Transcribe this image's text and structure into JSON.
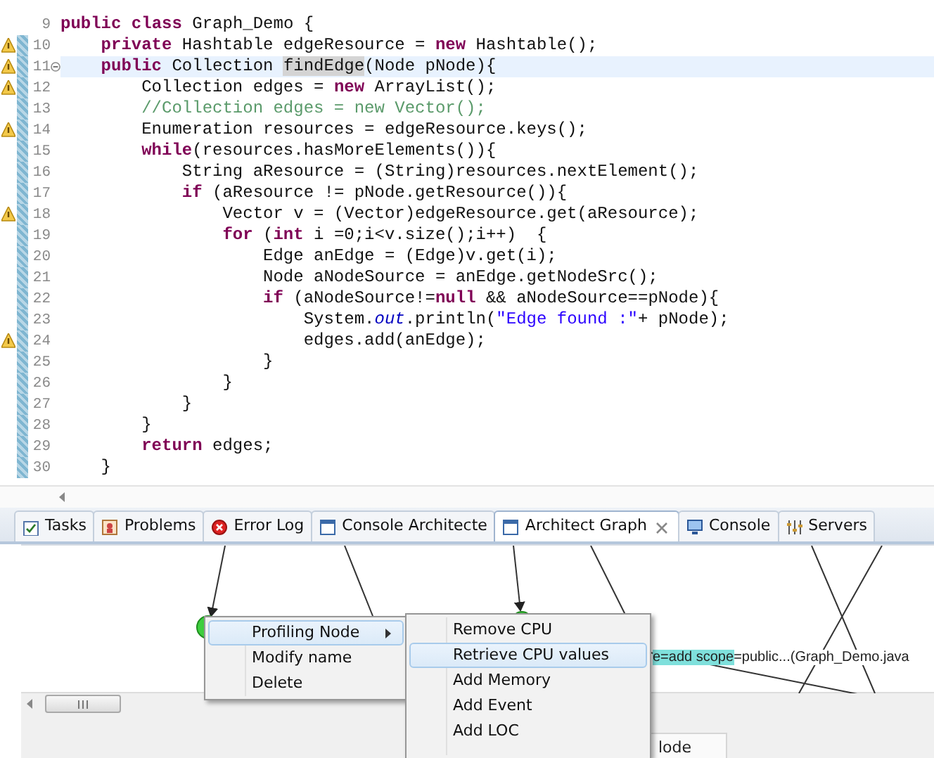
{
  "editor": {
    "lines": [
      {
        "number": "9",
        "warning": false,
        "foldable": false,
        "current": false,
        "changed": false,
        "tokens": [
          {
            "kind": "keyword",
            "text": "public "
          },
          {
            "kind": "keyword",
            "text": "class"
          },
          {
            "kind": "plain",
            "text": " Graph_Demo {"
          }
        ]
      },
      {
        "number": "10",
        "warning": true,
        "foldable": false,
        "current": false,
        "changed": true,
        "tokens": [
          {
            "kind": "keyword",
            "text": "    private"
          },
          {
            "kind": "plain",
            "text": " Hashtable edgeResource = "
          },
          {
            "kind": "keyword",
            "text": "new"
          },
          {
            "kind": "plain",
            "text": " Hashtable();"
          }
        ]
      },
      {
        "number": "11",
        "warning": true,
        "foldable": true,
        "current": true,
        "changed": true,
        "tokens": [
          {
            "kind": "keyword",
            "text": "    public"
          },
          {
            "kind": "plain",
            "text": " Collection "
          },
          {
            "kind": "occurrence",
            "text": "findEdge"
          },
          {
            "kind": "plain",
            "text": "(Node pNode){"
          }
        ]
      },
      {
        "number": "12",
        "warning": true,
        "foldable": false,
        "current": false,
        "changed": true,
        "tokens": [
          {
            "kind": "plain",
            "text": "        Collection edges = "
          },
          {
            "kind": "keyword",
            "text": "new"
          },
          {
            "kind": "plain",
            "text": " ArrayList();"
          }
        ]
      },
      {
        "number": "13",
        "warning": false,
        "foldable": false,
        "current": false,
        "changed": true,
        "tokens": [
          {
            "kind": "comment",
            "text": "        //Collection edges = new Vector();"
          }
        ]
      },
      {
        "number": "14",
        "warning": true,
        "foldable": false,
        "current": false,
        "changed": true,
        "tokens": [
          {
            "kind": "plain",
            "text": "        Enumeration resources = edgeResource.keys();"
          }
        ]
      },
      {
        "number": "15",
        "warning": false,
        "foldable": false,
        "current": false,
        "changed": true,
        "tokens": [
          {
            "kind": "keyword",
            "text": "        while"
          },
          {
            "kind": "plain",
            "text": "(resources.hasMoreElements()){"
          }
        ]
      },
      {
        "number": "16",
        "warning": false,
        "foldable": false,
        "current": false,
        "changed": true,
        "tokens": [
          {
            "kind": "plain",
            "text": "            String aResource = (String)resources.nextElement();"
          }
        ]
      },
      {
        "number": "17",
        "warning": false,
        "foldable": false,
        "current": false,
        "changed": true,
        "tokens": [
          {
            "kind": "keyword",
            "text": "            if"
          },
          {
            "kind": "plain",
            "text": " (aResource != pNode.getResource()){"
          }
        ]
      },
      {
        "number": "18",
        "warning": true,
        "foldable": false,
        "current": false,
        "changed": true,
        "tokens": [
          {
            "kind": "plain",
            "text": "                Vector v = (Vector)edgeResource.get(aResource);"
          }
        ]
      },
      {
        "number": "19",
        "warning": false,
        "foldable": false,
        "current": false,
        "changed": true,
        "tokens": [
          {
            "kind": "keyword",
            "text": "                for"
          },
          {
            "kind": "plain",
            "text": " ("
          },
          {
            "kind": "keyword",
            "text": "int"
          },
          {
            "kind": "plain",
            "text": " i =0;i<v.size();i++)  {"
          }
        ]
      },
      {
        "number": "20",
        "warning": false,
        "foldable": false,
        "current": false,
        "changed": true,
        "tokens": [
          {
            "kind": "plain",
            "text": "                    Edge anEdge = (Edge)v.get(i);"
          }
        ]
      },
      {
        "number": "21",
        "warning": false,
        "foldable": false,
        "current": false,
        "changed": true,
        "tokens": [
          {
            "kind": "plain",
            "text": "                    Node aNodeSource = anEdge.getNodeSrc();"
          }
        ]
      },
      {
        "number": "22",
        "warning": false,
        "foldable": false,
        "current": false,
        "changed": true,
        "tokens": [
          {
            "kind": "keyword",
            "text": "                    if"
          },
          {
            "kind": "plain",
            "text": " (aNodeSource!="
          },
          {
            "kind": "keyword",
            "text": "null"
          },
          {
            "kind": "plain",
            "text": " && aNodeSource==pNode){"
          }
        ]
      },
      {
        "number": "23",
        "warning": false,
        "foldable": false,
        "current": false,
        "changed": true,
        "tokens": [
          {
            "kind": "plain",
            "text": "                        System."
          },
          {
            "kind": "field",
            "text": "out"
          },
          {
            "kind": "plain",
            "text": ".println("
          },
          {
            "kind": "string",
            "text": "\"Edge found :\""
          },
          {
            "kind": "plain",
            "text": "+ pNode);"
          }
        ]
      },
      {
        "number": "24",
        "warning": true,
        "foldable": false,
        "current": false,
        "changed": true,
        "tokens": [
          {
            "kind": "plain",
            "text": "                        edges.add(anEdge);"
          }
        ]
      },
      {
        "number": "25",
        "warning": false,
        "foldable": false,
        "current": false,
        "changed": true,
        "tokens": [
          {
            "kind": "plain",
            "text": "                    }"
          }
        ]
      },
      {
        "number": "26",
        "warning": false,
        "foldable": false,
        "current": false,
        "changed": true,
        "tokens": [
          {
            "kind": "plain",
            "text": "                }"
          }
        ]
      },
      {
        "number": "27",
        "warning": false,
        "foldable": false,
        "current": false,
        "changed": true,
        "tokens": [
          {
            "kind": "plain",
            "text": "            }"
          }
        ]
      },
      {
        "number": "28",
        "warning": false,
        "foldable": false,
        "current": false,
        "changed": true,
        "tokens": [
          {
            "kind": "plain",
            "text": "        }"
          }
        ]
      },
      {
        "number": "29",
        "warning": false,
        "foldable": false,
        "current": false,
        "changed": true,
        "tokens": [
          {
            "kind": "keyword",
            "text": "        return"
          },
          {
            "kind": "plain",
            "text": " edges;"
          }
        ]
      },
      {
        "number": "30",
        "warning": false,
        "foldable": false,
        "current": false,
        "changed": true,
        "tokens": [
          {
            "kind": "plain",
            "text": "    }"
          }
        ]
      }
    ]
  },
  "panel_tabs": [
    {
      "label": "Tasks",
      "selected": false,
      "closable": false
    },
    {
      "label": "Problems",
      "selected": false,
      "closable": false
    },
    {
      "label": "Error Log",
      "selected": false,
      "closable": false
    },
    {
      "label": "Console Architecte",
      "selected": false,
      "closable": false
    },
    {
      "label": "Architect Graph",
      "selected": true,
      "closable": true
    },
    {
      "label": "Console",
      "selected": false,
      "closable": false
    },
    {
      "label": "Servers",
      "selected": false,
      "closable": false
    }
  ],
  "graph": {
    "label_parts": [
      {
        "text": "e=add scope",
        "highlighted": true
      },
      {
        "text": "=public...(Graph_Demo.java",
        "highlighted": false
      }
    ],
    "context_menu": [
      {
        "label": "Profiling Node",
        "selected": true,
        "has_submenu": true
      },
      {
        "label": "Modify name",
        "selected": false,
        "has_submenu": false
      },
      {
        "label": "Delete",
        "selected": false,
        "has_submenu": false
      }
    ],
    "submenu": [
      {
        "label": "Remove CPU",
        "selected": false
      },
      {
        "label": "Retrieve CPU values",
        "selected": true
      },
      {
        "label": "Add Memory",
        "selected": false
      },
      {
        "label": "Add Event",
        "selected": false
      },
      {
        "label": "Add LOC",
        "selected": false
      }
    ]
  },
  "bottom_field": {
    "text": "lode"
  }
}
